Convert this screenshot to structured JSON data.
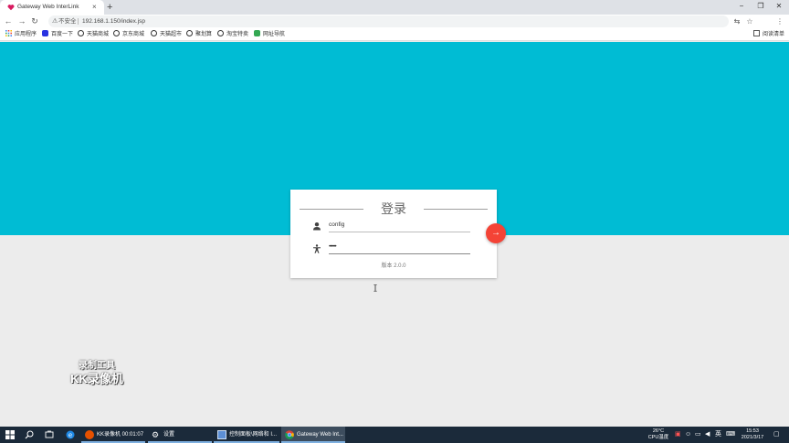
{
  "browser": {
    "tab_title": "Gateway Web InterLink",
    "tab_close": "×",
    "new_tab": "+",
    "window_controls": {
      "minimize": "−",
      "maximize": "❐",
      "close": "✕"
    },
    "nav": {
      "back": "←",
      "forward": "→",
      "reload": "↻"
    },
    "security_label": "不安全",
    "url": "192.168.1.150/index.jsp",
    "bookmarks": [
      {
        "label": "应用程序",
        "icon": "apps-grid-icon",
        "color": "#4285f4"
      },
      {
        "label": "百度一下",
        "icon": "baidu-icon",
        "color": "#2932e1"
      },
      {
        "label": "天猫商城",
        "icon": "globe-icon",
        "color": "#333333"
      },
      {
        "label": "京东商城",
        "icon": "globe-icon",
        "color": "#333333"
      },
      {
        "label": "天猫超市",
        "icon": "globe-icon",
        "color": "#333333"
      },
      {
        "label": "聚划算",
        "icon": "globe-icon",
        "color": "#333333"
      },
      {
        "label": "淘宝特卖",
        "icon": "globe-icon",
        "color": "#333333"
      },
      {
        "label": "网址导航",
        "icon": "nav-icon",
        "color": "#34a853"
      }
    ],
    "reading_list": "阅读清单"
  },
  "login": {
    "title": "登录",
    "username": "config",
    "password_mask": "••••••",
    "version": "版本 2.0.0",
    "submit_symbol": "→"
  },
  "watermark": {
    "line1": "录制工具",
    "line2": "KK录像机"
  },
  "taskbar": {
    "apps": [
      {
        "label": "KK录像机 00:01:07"
      },
      {
        "label": "设置"
      },
      {
        "label": "控制面板\\网络和 I..."
      },
      {
        "label": "Gateway Web Int..."
      }
    ],
    "weather_temp": "26°C",
    "weather_label": "CPU温度",
    "ime": "英",
    "time": "15:53",
    "date": "2021/3/17"
  },
  "colors": {
    "header_bg": "#00bcd4",
    "fab": "#f44336",
    "page_bg": "#ececec"
  }
}
